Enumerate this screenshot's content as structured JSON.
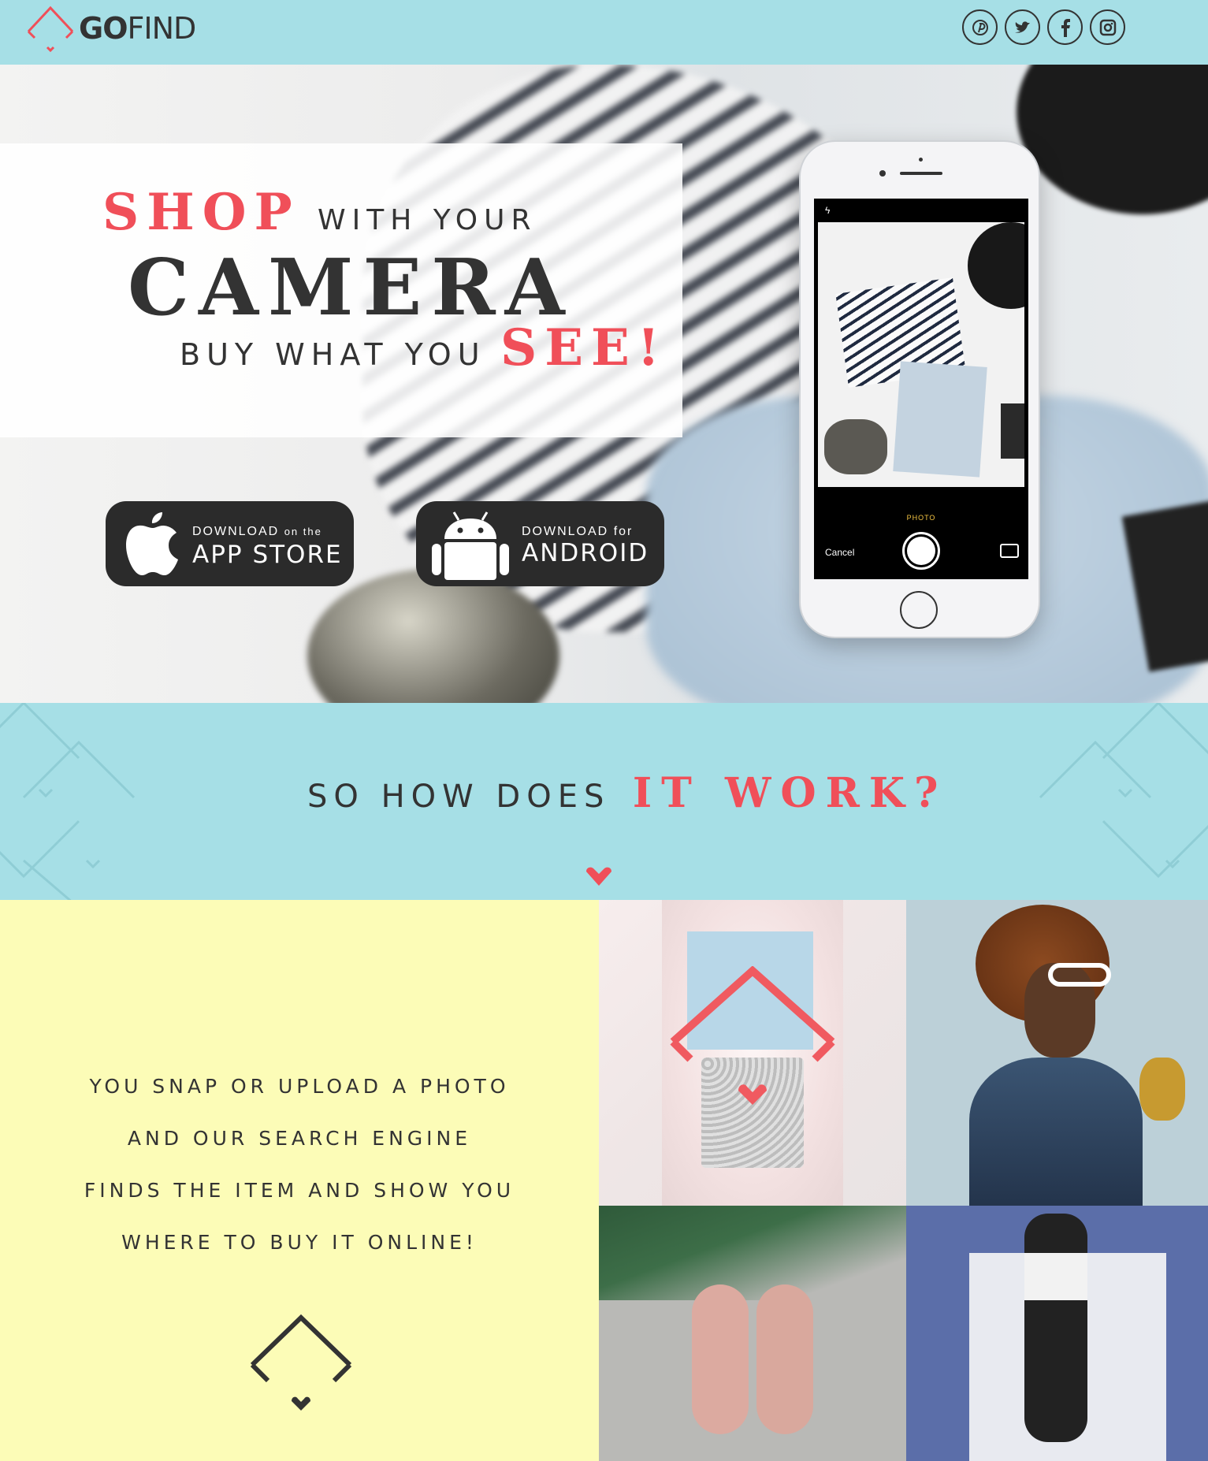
{
  "header": {
    "logo_go": "GO",
    "logo_find": "FIND",
    "socials": [
      "pinterest-icon",
      "twitter-icon",
      "facebook-icon",
      "instagram-icon"
    ]
  },
  "hero": {
    "shop": "SHOP",
    "with_your": "WITH YOUR",
    "camera": "CAMERA",
    "buy_what_you": "BUY WHAT YOU",
    "see": "SEE!",
    "appstore": {
      "line1_a": "DOWNLOAD",
      "line1_b": "on the",
      "line2": "APP STORE"
    },
    "android": {
      "line1_a": "DOWNLOAD",
      "line1_b": "for",
      "line2": "ANDROID"
    },
    "phone": {
      "mode_label": "PHOTO",
      "cancel_label": "Cancel"
    }
  },
  "how": {
    "title_a": "SO HOW DOES",
    "title_b": "IT WORK?"
  },
  "description": {
    "lines": [
      "YOU SNAP OR UPLOAD A PHOTO",
      "AND OUR SEARCH ENGINE",
      "FINDS THE ITEM AND SHOW YOU",
      "WHERE TO BUY IT ONLINE!"
    ]
  },
  "colors": {
    "accent": "#f04f59",
    "header_bg": "#a6dfe6",
    "yellow_bg": "#fcfcb7",
    "text_dark": "#333333"
  }
}
